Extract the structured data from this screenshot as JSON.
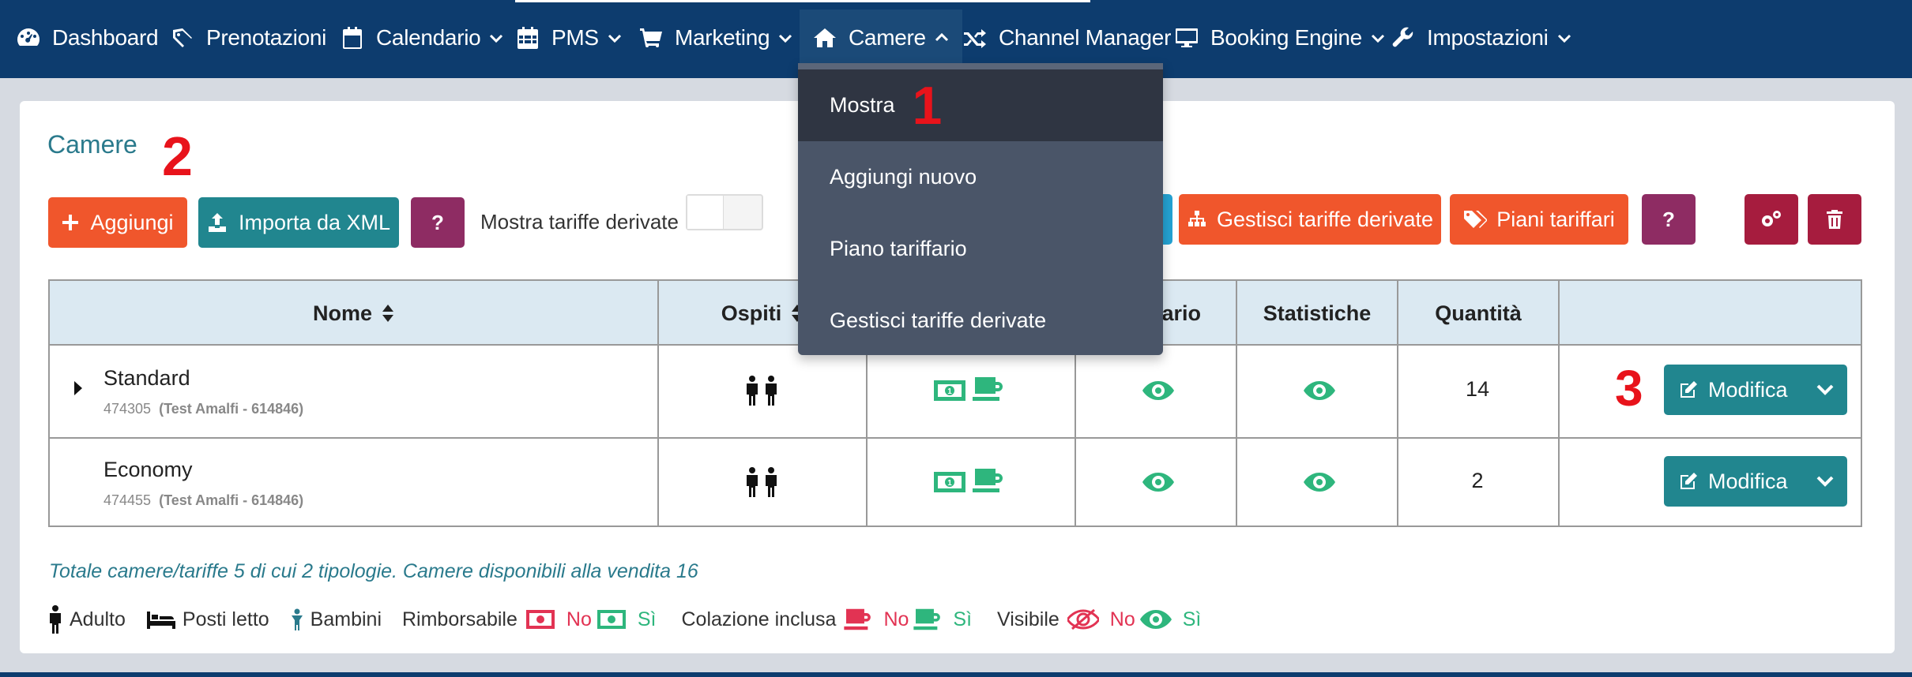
{
  "nav": {
    "dashboard": "Dashboard",
    "prenotazioni": "Prenotazioni",
    "calendario": "Calendario",
    "pms": "PMS",
    "marketing": "Marketing",
    "camere": "Camere",
    "channel_manager": "Channel Manager",
    "booking_engine": "Booking Engine",
    "impostazioni": "Impostazioni"
  },
  "dropdown": {
    "items": [
      "Mostra",
      "Aggiungi nuovo",
      "Piano tariffario",
      "Gestisci tariffe derivate"
    ]
  },
  "page": {
    "title": "Camere",
    "add": "Aggiungi",
    "import_xml": "Importa da XML",
    "help": "?",
    "toggle_label": "Mostra tariffe derivate",
    "manage_derived": "Gestisci tariffe derivate",
    "rate_plans": "Piani tariffari",
    "help2": "?"
  },
  "table": {
    "headers": {
      "nome": "Nome",
      "ospiti": "Ospiti",
      "calendario_partial": "dario",
      "statistiche": "Statistiche",
      "quantita": "Quantità"
    },
    "rows": [
      {
        "name": "Standard",
        "id": "474305",
        "property": "(Test Amalfi - 614846)",
        "qty": "14",
        "action": "Modifica"
      },
      {
        "name": "Economy",
        "id": "474455",
        "property": "(Test Amalfi - 614846)",
        "qty": "2",
        "action": "Modifica"
      }
    ]
  },
  "footer": {
    "note": "Totale camere/tariffe 5 di cui 2 tipologie. Camere disponibili alla vendita 16",
    "legend": {
      "adulto": "Adulto",
      "posti_letto": "Posti letto",
      "bambini": "Bambini",
      "rimborsabile": "Rimborsabile",
      "colazione": "Colazione inclusa",
      "visibile": "Visibile",
      "no": "No",
      "si": "Sì"
    }
  },
  "annotations": {
    "one": "1",
    "two": "2",
    "three": "3"
  },
  "colors": {
    "navbar": "#0d3c6e",
    "orange": "#f0562c",
    "teal": "#21868f",
    "purple": "#8e2c63",
    "crimson": "#a61c3e",
    "green": "#2eb67d",
    "red_no": "#e23353"
  }
}
